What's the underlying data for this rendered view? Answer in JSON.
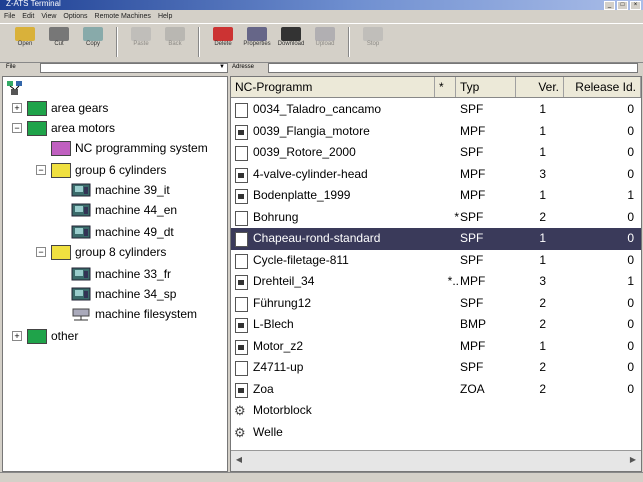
{
  "window": {
    "title": "Z-ATS Terminal"
  },
  "menu": [
    "File",
    "Edit",
    "View",
    "Options",
    "Remote Machines",
    "Help"
  ],
  "toolbar": {
    "items": [
      {
        "label": "Open",
        "icon": "folder-open-icon",
        "disabled": false
      },
      {
        "label": "Cut",
        "icon": "scissors-icon",
        "disabled": false
      },
      {
        "label": "Copy",
        "icon": "copy-icon",
        "disabled": false
      },
      {
        "label": "Paste",
        "icon": "paste-icon",
        "disabled": true
      },
      {
        "label": "Back",
        "icon": "back-arrow-icon",
        "disabled": true
      },
      {
        "label": "Delete",
        "icon": "delete-icon",
        "disabled": false
      },
      {
        "label": "Properties",
        "icon": "properties-icon",
        "disabled": false
      },
      {
        "label": "Download",
        "icon": "download-icon",
        "disabled": false
      },
      {
        "label": "Upload",
        "icon": "upload-icon",
        "disabled": true
      },
      {
        "label": "Stop",
        "icon": "stop-icon",
        "disabled": true
      }
    ]
  },
  "address": {
    "left_label": "File",
    "right_label": "Adresse"
  },
  "tree": [
    {
      "label": "area gears",
      "level": 0,
      "expander": "+",
      "icon": "green-folder-icon"
    },
    {
      "label": "area motors",
      "level": 0,
      "expander": "−",
      "icon": "green-folder-icon"
    },
    {
      "label": "NC programming system",
      "level": 1,
      "expander": "",
      "icon": "magenta-folder-icon"
    },
    {
      "label": "group 6 cylinders",
      "level": 1,
      "expander": "−",
      "icon": "yellow-folder-icon"
    },
    {
      "label": "machine 39_it",
      "level": 2,
      "expander": "",
      "icon": "machine-icon"
    },
    {
      "label": "machine 44_en",
      "level": 2,
      "expander": "",
      "icon": "machine-icon"
    },
    {
      "label": "machine 49_dt",
      "level": 2,
      "expander": "",
      "icon": "machine-icon"
    },
    {
      "label": "group 8 cylinders",
      "level": 1,
      "expander": "−",
      "icon": "yellow-folder-icon"
    },
    {
      "label": "machine 33_fr",
      "level": 2,
      "expander": "",
      "icon": "machine-icon"
    },
    {
      "label": "machine 34_sp",
      "level": 2,
      "expander": "",
      "icon": "machine-icon"
    },
    {
      "label": "machine filesystem",
      "level": 2,
      "expander": "",
      "icon": "network-drive-icon"
    },
    {
      "label": "other",
      "level": 0,
      "expander": "+",
      "icon": "green-folder-icon"
    }
  ],
  "list": {
    "columns": [
      "NC-Programm",
      "*",
      "Typ",
      "Ver.",
      "Release Id."
    ],
    "rows": [
      {
        "name": "0034_Taladro_cancamo",
        "mark": "",
        "typ": "SPF",
        "ver": "1",
        "rel": "0",
        "icon": "file"
      },
      {
        "name": "0039_Flangia_motore",
        "mark": "",
        "typ": "MPF",
        "ver": "1",
        "rel": "0",
        "icon": "file-graphic"
      },
      {
        "name": "0039_Rotore_2000",
        "mark": "",
        "typ": "SPF",
        "ver": "1",
        "rel": "0",
        "icon": "file"
      },
      {
        "name": "4-valve-cylinder-head",
        "mark": "",
        "typ": "MPF",
        "ver": "3",
        "rel": "0",
        "icon": "file-graphic"
      },
      {
        "name": "Bodenplatte_1999",
        "mark": "",
        "typ": "MPF",
        "ver": "1",
        "rel": "1",
        "icon": "file-graphic"
      },
      {
        "name": "Bohrung",
        "mark": "*",
        "typ": "SPF",
        "ver": "2",
        "rel": "0",
        "icon": "file"
      },
      {
        "name": "Chapeau-rond-standard",
        "mark": "",
        "typ": "SPF",
        "ver": "1",
        "rel": "0",
        "icon": "file",
        "selected": true
      },
      {
        "name": "Cycle-filetage-811",
        "mark": "",
        "typ": "SPF",
        "ver": "1",
        "rel": "0",
        "icon": "file"
      },
      {
        "name": "Drehteil_34",
        "mark": "*..",
        "typ": "MPF",
        "ver": "3",
        "rel": "1",
        "icon": "file-graphic"
      },
      {
        "name": "Führung12",
        "mark": "",
        "typ": "SPF",
        "ver": "2",
        "rel": "0",
        "icon": "file"
      },
      {
        "name": "L-Blech",
        "mark": "",
        "typ": "BMP",
        "ver": "2",
        "rel": "0",
        "icon": "file-graphic"
      },
      {
        "name": "Motor_z2",
        "mark": "",
        "typ": "MPF",
        "ver": "1",
        "rel": "0",
        "icon": "file-graphic"
      },
      {
        "name": "Z4711-up",
        "mark": "",
        "typ": "SPF",
        "ver": "2",
        "rel": "0",
        "icon": "file"
      },
      {
        "name": "Zoa",
        "mark": "",
        "typ": "ZOA",
        "ver": "2",
        "rel": "0",
        "icon": "file-graphic"
      },
      {
        "name": "Motorblock",
        "mark": "",
        "typ": "",
        "ver": "",
        "rel": "",
        "icon": "gear"
      },
      {
        "name": "Welle",
        "mark": "",
        "typ": "",
        "ver": "",
        "rel": "",
        "icon": "gear"
      }
    ]
  }
}
